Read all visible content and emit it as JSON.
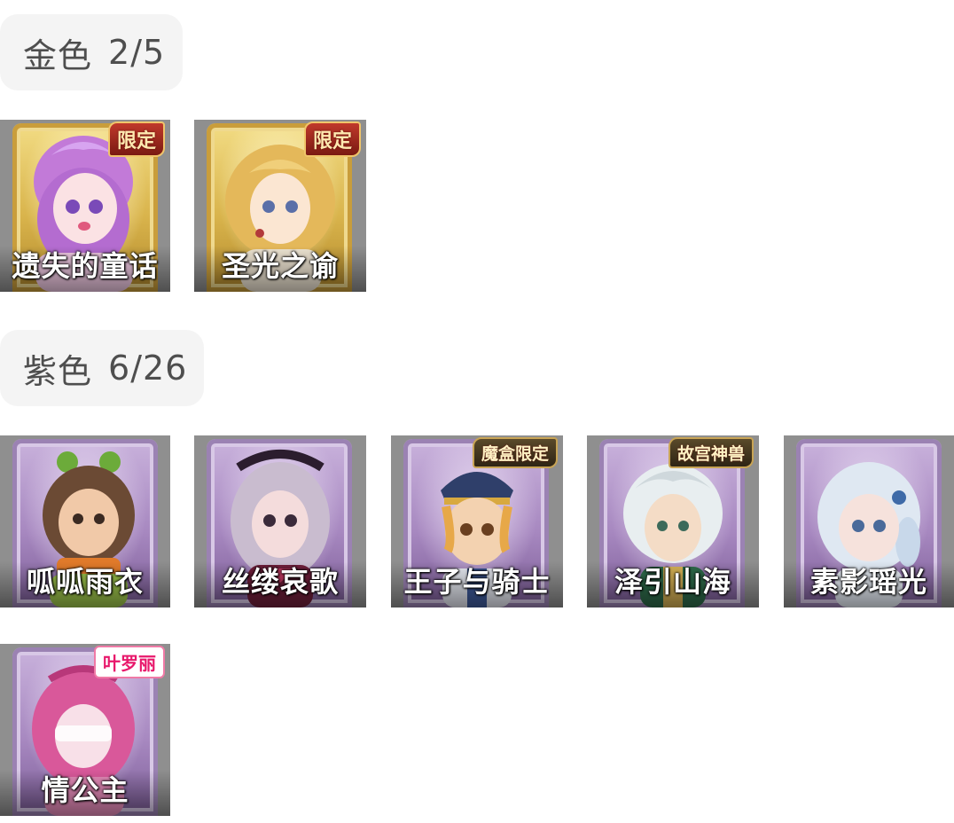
{
  "sections": [
    {
      "name": "金色",
      "count": "2/5"
    },
    {
      "name": "紫色",
      "count": "6/26"
    }
  ],
  "gold_items": [
    {
      "label": "遗失的童话",
      "badge": "限定"
    },
    {
      "label": "圣光之谕",
      "badge": "限定"
    }
  ],
  "purple_items": [
    {
      "label": "呱呱雨衣",
      "badge": ""
    },
    {
      "label": "丝缕哀歌",
      "badge": ""
    },
    {
      "label": "王子与骑士",
      "badge": "魔盒限定"
    },
    {
      "label": "泽引山海",
      "badge": "故宫神兽"
    },
    {
      "label": "素影瑶光",
      "badge": ""
    },
    {
      "label": "情公主",
      "badge": "叶罗丽"
    }
  ],
  "colors": {
    "gold": "#d9b44c",
    "purple": "#a788c0",
    "pill": "#f4f4f4"
  }
}
